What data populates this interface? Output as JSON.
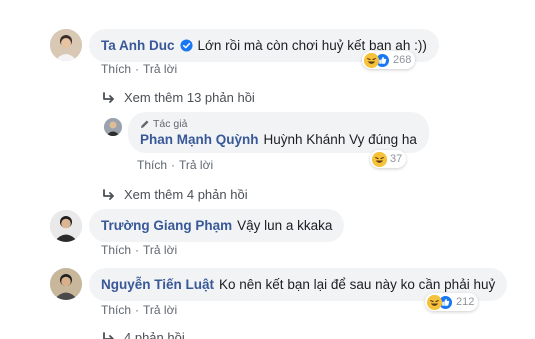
{
  "comments": [
    {
      "name": "Ta Anh Duc",
      "verified": true,
      "text": "Lớn rồi mà còn chơi huỷ kết bạn ah :))",
      "reaction_count": "268",
      "like_label": "Thích",
      "reply_label": "Trả lời",
      "more_replies": "Xem thêm 13 phản hồi"
    },
    {
      "author_badge": "Tác giả",
      "name": "Phan Mạnh Quỳnh",
      "text": "Huỳnh Khánh Vy đúng ha",
      "reaction_count": "37",
      "like_label": "Thích",
      "reply_label": "Trả lời",
      "more_replies": "Xem thêm 4 phản hồi"
    },
    {
      "name": "Trường Giang Phạm",
      "text": "Vậy lun a kkaka",
      "like_label": "Thích",
      "reply_label": "Trả lời"
    },
    {
      "name": "Nguyễn Tiến Luật",
      "text": "Ko nên kết bạn lại để sau này ko cần phải huỷ",
      "reaction_count": "212",
      "like_label": "Thích",
      "reply_label": "Trả lời",
      "more_replies": "4 phản hồi"
    }
  ],
  "separator": "·",
  "icons": {
    "verified": "verified-badge-icon",
    "reply_arrow": "reply-arrow-icon",
    "author": "pencil-icon",
    "haha": "haha-reaction-icon",
    "like": "like-reaction-icon"
  },
  "colors": {
    "name": "#385898",
    "bubble": "#f2f3f5",
    "meta": "#606770",
    "like_blue": "#1877f2",
    "haha_yellow": "#f7c23b"
  }
}
